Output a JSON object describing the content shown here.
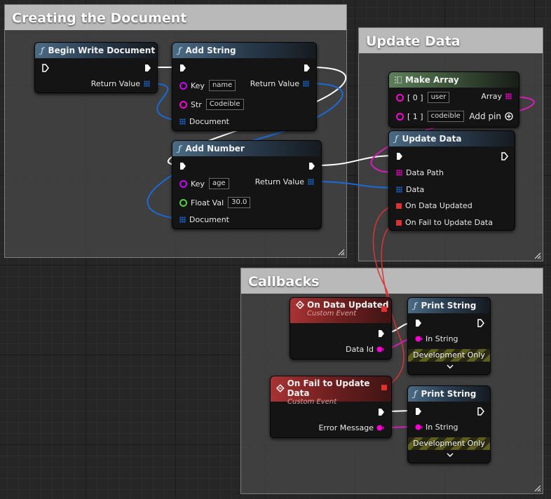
{
  "comments": {
    "creating": "Creating the Document",
    "update": "Update Data",
    "callbacks": "Callbacks"
  },
  "nodes": {
    "begin_write": {
      "title": "Begin Write Document",
      "return_value": "Return Value"
    },
    "add_string": {
      "title": "Add String",
      "key_label": "Key",
      "key_value": "name",
      "str_label": "Str",
      "str_value": "Codeible",
      "document_label": "Document",
      "return_value": "Return Value"
    },
    "add_number": {
      "title": "Add Number",
      "key_label": "Key",
      "key_value": "age",
      "float_label": "Float Val",
      "float_value": "30.0",
      "document_label": "Document",
      "return_value": "Return Value"
    },
    "make_array": {
      "title": "Make Array",
      "item0_label": "[ 0 ]",
      "item0_value": "user",
      "item1_label": "[ 1 ]",
      "item1_value": "codeible",
      "array_label": "Array",
      "add_pin": "Add pin"
    },
    "update_data": {
      "title": "Update Data",
      "data_path": "Data Path",
      "data": "Data",
      "on_updated": "On Data Updated",
      "on_fail": "On Fail to Update Data"
    },
    "event_updated": {
      "title": "On Data Updated",
      "subtitle": "Custom Event",
      "pin": "Data Id"
    },
    "event_fail": {
      "title": "On Fail to Update Data",
      "subtitle": "Custom Event",
      "pin": "Error Message"
    },
    "print1": {
      "title": "Print String",
      "in_string": "In String",
      "dev_only": "Development Only"
    },
    "print2": {
      "title": "Print String",
      "in_string": "In String",
      "dev_only": "Development Only"
    }
  },
  "icons": {
    "function": "function-icon",
    "exec": "exec-pin-icon",
    "event": "event-diamond-icon",
    "make_array": "make-array-icon",
    "add": "add-circle-icon",
    "expand": "chevron-down-icon"
  },
  "colors": {
    "exec": "#ffffff",
    "string": "#ff00d4",
    "name": "#c900ff",
    "float": "#53d13b",
    "object": "#1a6bd8",
    "delegate": "#e03131"
  }
}
